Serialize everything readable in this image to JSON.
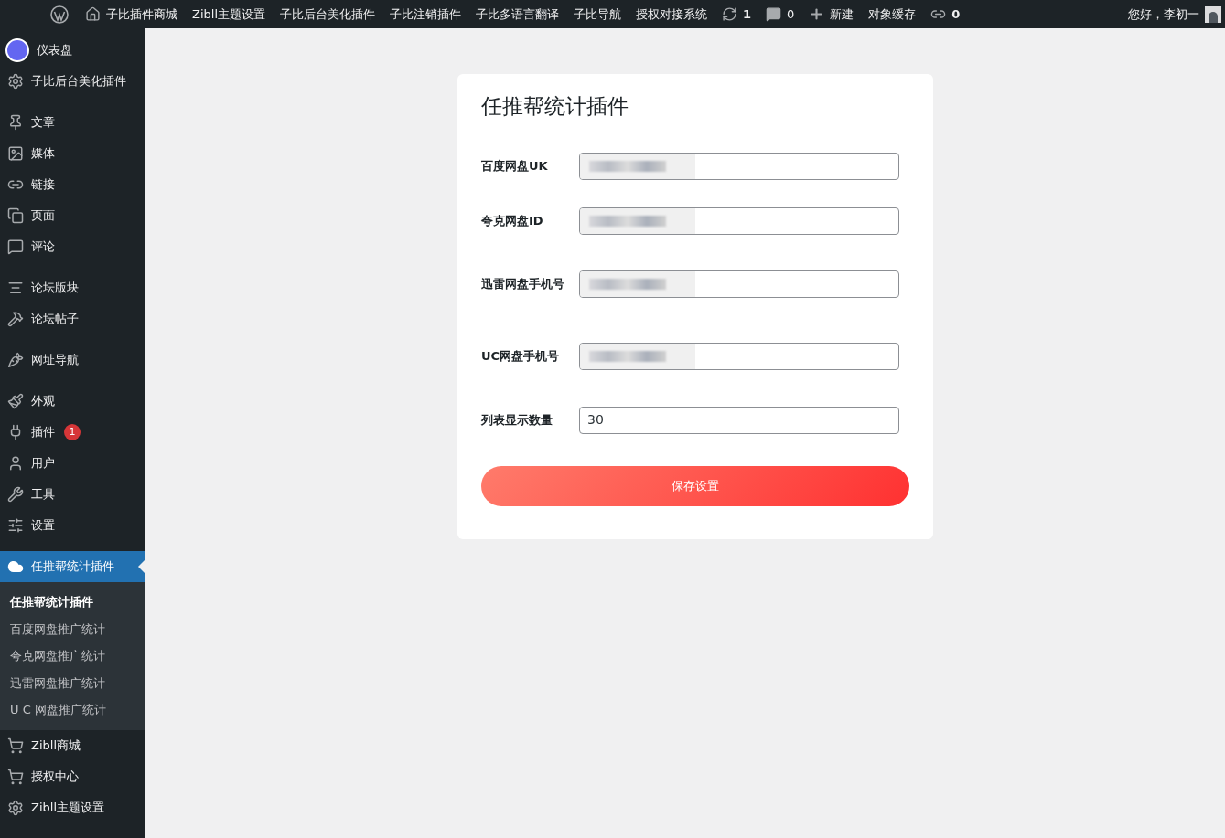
{
  "top_bar": {
    "items": [
      {
        "kind": "logo"
      },
      {
        "kind": "home",
        "text": "子比插件商城"
      },
      {
        "kind": "text",
        "text": "Zibll主题设置"
      },
      {
        "kind": "text",
        "text": "子比后台美化插件"
      },
      {
        "kind": "text",
        "text": "子比注销插件"
      },
      {
        "kind": "text",
        "text": "子比多语言翻译"
      },
      {
        "kind": "text",
        "text": "子比导航"
      },
      {
        "kind": "text",
        "text": "授权对接系统"
      },
      {
        "kind": "updates",
        "text": "1"
      },
      {
        "kind": "comments",
        "text": "0"
      },
      {
        "kind": "new",
        "text": "新建"
      },
      {
        "kind": "text",
        "text": "对象缓存"
      },
      {
        "kind": "links",
        "text": "0"
      }
    ],
    "greeting": "您好，李初一"
  },
  "sidebar": {
    "items": [
      {
        "label": "仪表盘",
        "selected": false
      },
      {
        "label": "子比后台美化插件",
        "selected": false
      },
      {
        "label": "文章",
        "selected": false
      },
      {
        "label": "媒体",
        "selected": false
      },
      {
        "label": "链接",
        "selected": false
      },
      {
        "label": "页面",
        "selected": false
      },
      {
        "label": "评论",
        "selected": false
      },
      {
        "label": "论坛版块",
        "selected": false
      },
      {
        "label": "论坛帖子",
        "selected": false
      },
      {
        "label": "网址导航",
        "selected": false
      },
      {
        "label": "外观",
        "selected": false
      },
      {
        "label": "插件",
        "badge": "1",
        "selected": false
      },
      {
        "label": "用户",
        "selected": false
      },
      {
        "label": "工具",
        "selected": false
      },
      {
        "label": "设置",
        "selected": false
      },
      {
        "label": "任推帮统计插件",
        "selected": true,
        "children": [
          {
            "label": "任推帮统计插件",
            "selected": true
          },
          {
            "label": "百度网盘推广统计",
            "selected": false
          },
          {
            "label": "夸克网盘推广统计",
            "selected": false
          },
          {
            "label": "迅雷网盘推广统计",
            "selected": false
          },
          {
            "label": "U C 网盘推广统计",
            "selected": false
          }
        ]
      },
      {
        "label": "Zibll商城",
        "selected": false
      },
      {
        "label": "授权中心",
        "selected": false
      },
      {
        "label": "Zibll主题设置",
        "selected": false
      }
    ]
  },
  "card": {
    "title": "任推帮统计插件",
    "fields": [
      {
        "label": "百度网盘UK",
        "redacted": true
      },
      {
        "label": "夸克网盘ID",
        "redacted": true
      },
      {
        "label": "迅雷网盘手机号",
        "redacted": true
      },
      {
        "label": "UC网盘手机号",
        "redacted": true
      },
      {
        "label": "列表显示数量",
        "value": "30",
        "redacted": false
      }
    ],
    "save_button": "保存设置"
  }
}
